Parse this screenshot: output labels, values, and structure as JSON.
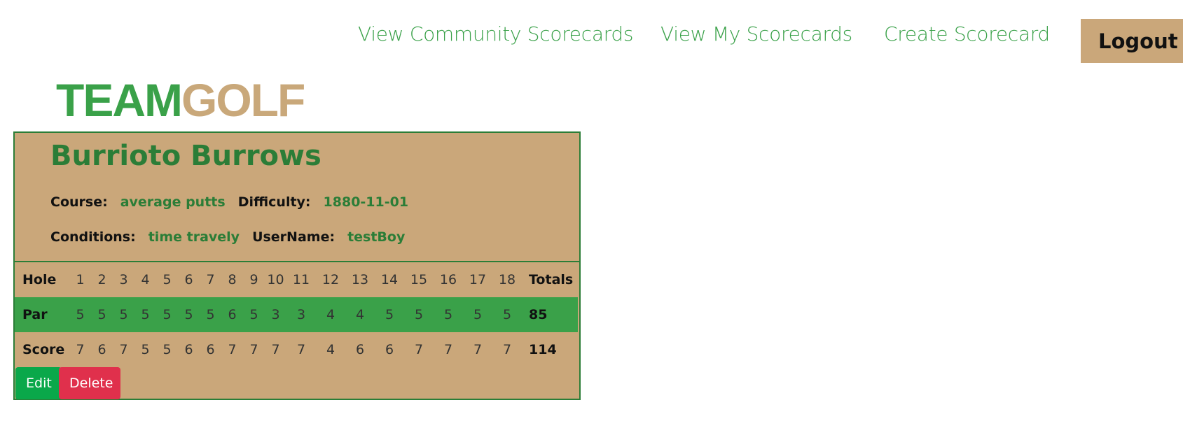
{
  "nav": {
    "community_label": "View Community Scorecards",
    "my_label": "View My Scorecards",
    "create_label": "Create Scorecard",
    "logout_label": "Logout"
  },
  "logo": {
    "part1": "TEAM",
    "part2": "GOLF"
  },
  "card": {
    "title": "Burrioto Burrows",
    "course_label": "Course:",
    "course_value": "average putts",
    "difficulty_label": "Difficulty:",
    "difficulty_value": "1880-11-01",
    "conditions_label": "Conditions:",
    "conditions_value": "time travely",
    "username_label": "UserName:",
    "username_value": "testBoy"
  },
  "scorecard": {
    "hole_label": "Hole",
    "par_label": "Par",
    "score_label": "Score",
    "totals_label": "Totals",
    "holes": [
      "1",
      "2",
      "3",
      "4",
      "5",
      "6",
      "7",
      "8",
      "9",
      "10",
      "11",
      "12",
      "13",
      "14",
      "15",
      "16",
      "17",
      "18"
    ],
    "par": [
      "5",
      "5",
      "5",
      "5",
      "5",
      "5",
      "5",
      "6",
      "5",
      "3",
      "3",
      "4",
      "4",
      "5",
      "5",
      "5",
      "5",
      "5"
    ],
    "par_total": "85",
    "score": [
      "7",
      "6",
      "7",
      "5",
      "5",
      "6",
      "6",
      "7",
      "7",
      "7",
      "7",
      "4",
      "6",
      "6",
      "7",
      "7",
      "7",
      "7"
    ],
    "score_total": "114"
  },
  "actions": {
    "edit_label": "Edit",
    "delete_label": "Delete"
  },
  "colors": {
    "green": "#3aa149",
    "dark_green": "#2b7d37",
    "tan": "#caa77a",
    "edit_green": "#0aa84a",
    "delete_red": "#e0304c"
  }
}
